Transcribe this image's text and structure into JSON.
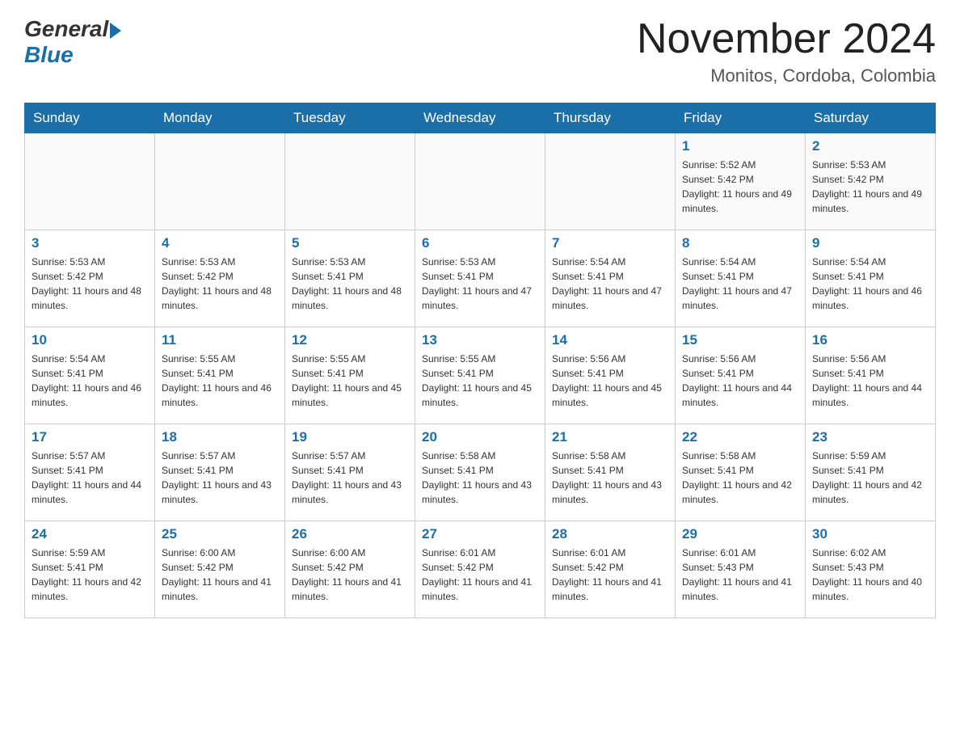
{
  "header": {
    "logo_general": "General",
    "logo_blue": "Blue",
    "month_title": "November 2024",
    "location": "Monitos, Cordoba, Colombia"
  },
  "days_of_week": [
    "Sunday",
    "Monday",
    "Tuesday",
    "Wednesday",
    "Thursday",
    "Friday",
    "Saturday"
  ],
  "weeks": [
    [
      {
        "day": "",
        "sunrise": "",
        "sunset": "",
        "daylight": ""
      },
      {
        "day": "",
        "sunrise": "",
        "sunset": "",
        "daylight": ""
      },
      {
        "day": "",
        "sunrise": "",
        "sunset": "",
        "daylight": ""
      },
      {
        "day": "",
        "sunrise": "",
        "sunset": "",
        "daylight": ""
      },
      {
        "day": "",
        "sunrise": "",
        "sunset": "",
        "daylight": ""
      },
      {
        "day": "1",
        "sunrise": "Sunrise: 5:52 AM",
        "sunset": "Sunset: 5:42 PM",
        "daylight": "Daylight: 11 hours and 49 minutes."
      },
      {
        "day": "2",
        "sunrise": "Sunrise: 5:53 AM",
        "sunset": "Sunset: 5:42 PM",
        "daylight": "Daylight: 11 hours and 49 minutes."
      }
    ],
    [
      {
        "day": "3",
        "sunrise": "Sunrise: 5:53 AM",
        "sunset": "Sunset: 5:42 PM",
        "daylight": "Daylight: 11 hours and 48 minutes."
      },
      {
        "day": "4",
        "sunrise": "Sunrise: 5:53 AM",
        "sunset": "Sunset: 5:42 PM",
        "daylight": "Daylight: 11 hours and 48 minutes."
      },
      {
        "day": "5",
        "sunrise": "Sunrise: 5:53 AM",
        "sunset": "Sunset: 5:41 PM",
        "daylight": "Daylight: 11 hours and 48 minutes."
      },
      {
        "day": "6",
        "sunrise": "Sunrise: 5:53 AM",
        "sunset": "Sunset: 5:41 PM",
        "daylight": "Daylight: 11 hours and 47 minutes."
      },
      {
        "day": "7",
        "sunrise": "Sunrise: 5:54 AM",
        "sunset": "Sunset: 5:41 PM",
        "daylight": "Daylight: 11 hours and 47 minutes."
      },
      {
        "day": "8",
        "sunrise": "Sunrise: 5:54 AM",
        "sunset": "Sunset: 5:41 PM",
        "daylight": "Daylight: 11 hours and 47 minutes."
      },
      {
        "day": "9",
        "sunrise": "Sunrise: 5:54 AM",
        "sunset": "Sunset: 5:41 PM",
        "daylight": "Daylight: 11 hours and 46 minutes."
      }
    ],
    [
      {
        "day": "10",
        "sunrise": "Sunrise: 5:54 AM",
        "sunset": "Sunset: 5:41 PM",
        "daylight": "Daylight: 11 hours and 46 minutes."
      },
      {
        "day": "11",
        "sunrise": "Sunrise: 5:55 AM",
        "sunset": "Sunset: 5:41 PM",
        "daylight": "Daylight: 11 hours and 46 minutes."
      },
      {
        "day": "12",
        "sunrise": "Sunrise: 5:55 AM",
        "sunset": "Sunset: 5:41 PM",
        "daylight": "Daylight: 11 hours and 45 minutes."
      },
      {
        "day": "13",
        "sunrise": "Sunrise: 5:55 AM",
        "sunset": "Sunset: 5:41 PM",
        "daylight": "Daylight: 11 hours and 45 minutes."
      },
      {
        "day": "14",
        "sunrise": "Sunrise: 5:56 AM",
        "sunset": "Sunset: 5:41 PM",
        "daylight": "Daylight: 11 hours and 45 minutes."
      },
      {
        "day": "15",
        "sunrise": "Sunrise: 5:56 AM",
        "sunset": "Sunset: 5:41 PM",
        "daylight": "Daylight: 11 hours and 44 minutes."
      },
      {
        "day": "16",
        "sunrise": "Sunrise: 5:56 AM",
        "sunset": "Sunset: 5:41 PM",
        "daylight": "Daylight: 11 hours and 44 minutes."
      }
    ],
    [
      {
        "day": "17",
        "sunrise": "Sunrise: 5:57 AM",
        "sunset": "Sunset: 5:41 PM",
        "daylight": "Daylight: 11 hours and 44 minutes."
      },
      {
        "day": "18",
        "sunrise": "Sunrise: 5:57 AM",
        "sunset": "Sunset: 5:41 PM",
        "daylight": "Daylight: 11 hours and 43 minutes."
      },
      {
        "day": "19",
        "sunrise": "Sunrise: 5:57 AM",
        "sunset": "Sunset: 5:41 PM",
        "daylight": "Daylight: 11 hours and 43 minutes."
      },
      {
        "day": "20",
        "sunrise": "Sunrise: 5:58 AM",
        "sunset": "Sunset: 5:41 PM",
        "daylight": "Daylight: 11 hours and 43 minutes."
      },
      {
        "day": "21",
        "sunrise": "Sunrise: 5:58 AM",
        "sunset": "Sunset: 5:41 PM",
        "daylight": "Daylight: 11 hours and 43 minutes."
      },
      {
        "day": "22",
        "sunrise": "Sunrise: 5:58 AM",
        "sunset": "Sunset: 5:41 PM",
        "daylight": "Daylight: 11 hours and 42 minutes."
      },
      {
        "day": "23",
        "sunrise": "Sunrise: 5:59 AM",
        "sunset": "Sunset: 5:41 PM",
        "daylight": "Daylight: 11 hours and 42 minutes."
      }
    ],
    [
      {
        "day": "24",
        "sunrise": "Sunrise: 5:59 AM",
        "sunset": "Sunset: 5:41 PM",
        "daylight": "Daylight: 11 hours and 42 minutes."
      },
      {
        "day": "25",
        "sunrise": "Sunrise: 6:00 AM",
        "sunset": "Sunset: 5:42 PM",
        "daylight": "Daylight: 11 hours and 41 minutes."
      },
      {
        "day": "26",
        "sunrise": "Sunrise: 6:00 AM",
        "sunset": "Sunset: 5:42 PM",
        "daylight": "Daylight: 11 hours and 41 minutes."
      },
      {
        "day": "27",
        "sunrise": "Sunrise: 6:01 AM",
        "sunset": "Sunset: 5:42 PM",
        "daylight": "Daylight: 11 hours and 41 minutes."
      },
      {
        "day": "28",
        "sunrise": "Sunrise: 6:01 AM",
        "sunset": "Sunset: 5:42 PM",
        "daylight": "Daylight: 11 hours and 41 minutes."
      },
      {
        "day": "29",
        "sunrise": "Sunrise: 6:01 AM",
        "sunset": "Sunset: 5:43 PM",
        "daylight": "Daylight: 11 hours and 41 minutes."
      },
      {
        "day": "30",
        "sunrise": "Sunrise: 6:02 AM",
        "sunset": "Sunset: 5:43 PM",
        "daylight": "Daylight: 11 hours and 40 minutes."
      }
    ]
  ]
}
